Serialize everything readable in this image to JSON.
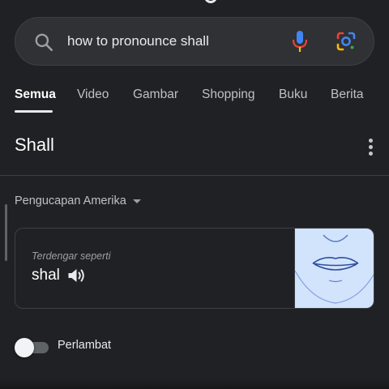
{
  "search": {
    "query": "how to pronounce shall",
    "icons": [
      "search-icon",
      "mic-icon",
      "google-lens-icon"
    ]
  },
  "tabs": [
    {
      "label": "Semua",
      "active": true
    },
    {
      "label": "Video",
      "active": false
    },
    {
      "label": "Gambar",
      "active": false
    },
    {
      "label": "Shopping",
      "active": false
    },
    {
      "label": "Buku",
      "active": false
    },
    {
      "label": "Berita",
      "active": false
    }
  ],
  "result": {
    "heading": "Shall",
    "accent": "Pengucapan Amerika",
    "card": {
      "sounds_like_label": "Terdengar seperti",
      "phonetic": "shal"
    },
    "slow_toggle": {
      "label": "Perlambat",
      "on": false
    }
  },
  "colors": {
    "background": "#202124",
    "search_bar": "#303134",
    "mic_blue": "#4285f4",
    "mic_red": "#ea4335",
    "lens_yellow": "#fbbc04",
    "lens_green": "#34a853",
    "mouth_panel": "#d2e3fc"
  }
}
